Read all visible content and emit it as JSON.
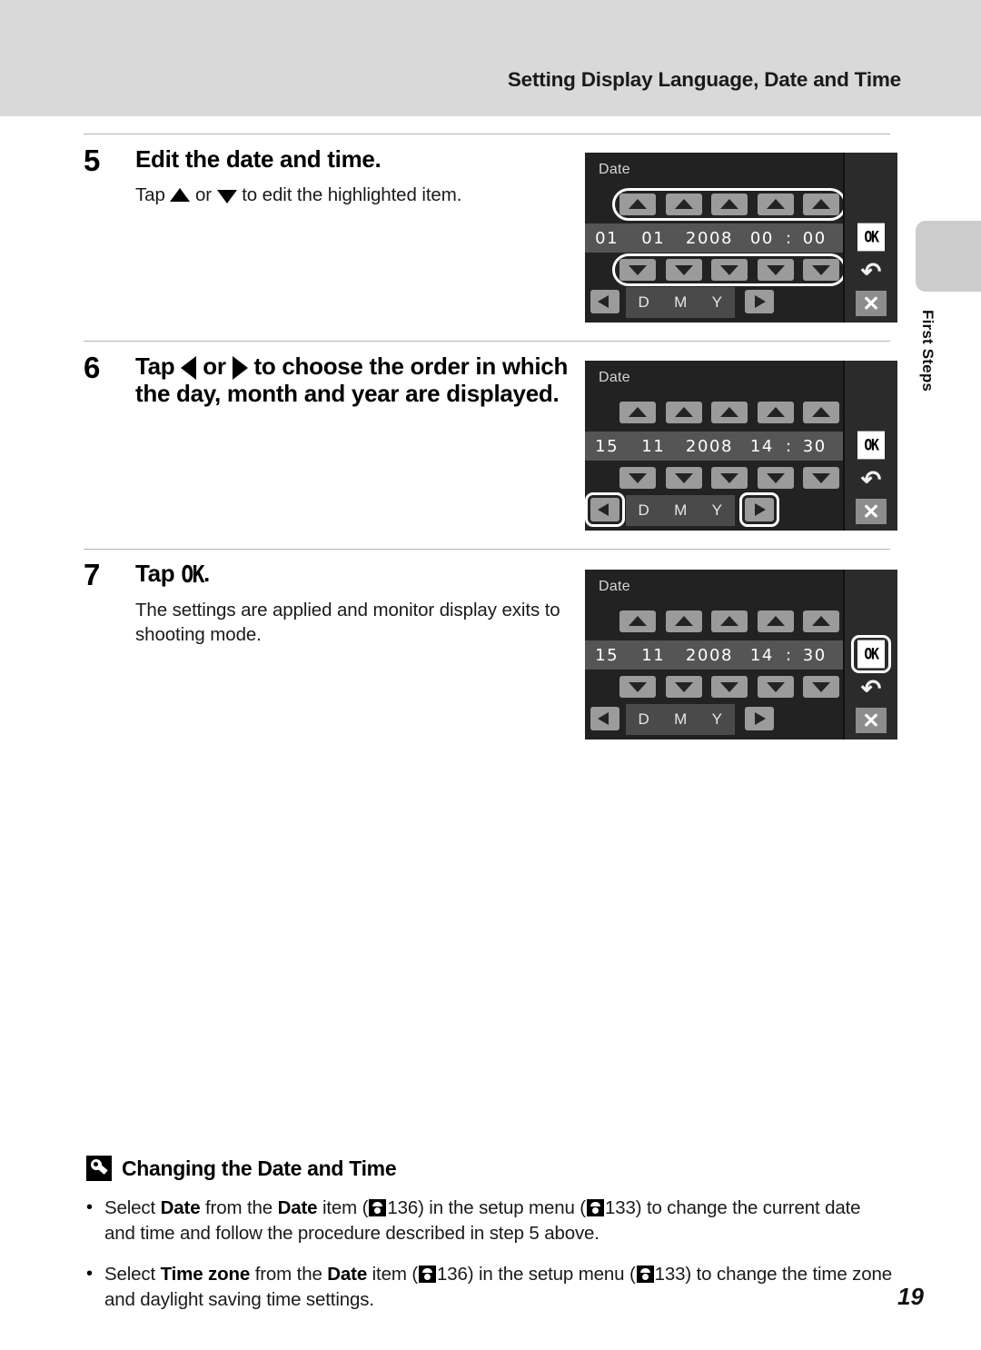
{
  "header": {
    "title": "Setting Display Language, Date and Time"
  },
  "side_tab": {
    "label": "First Steps"
  },
  "steps": [
    {
      "number": "5",
      "heading": "Edit the date and time.",
      "desc_before": "Tap ",
      "desc_mid": " or ",
      "desc_after": " to edit the highlighted item."
    },
    {
      "number": "6",
      "heading_before": "Tap ",
      "heading_mid": " or ",
      "heading_after": " to choose the order in which the day, month and year are displayed."
    },
    {
      "number": "7",
      "heading_before": "Tap ",
      "heading_ok": "OK",
      "heading_after": ".",
      "desc": "The settings are applied and monitor display exits to shooting mode."
    }
  ],
  "screens": [
    {
      "title": "Date",
      "value": {
        "day": "01",
        "month": "01",
        "year": "2008",
        "hour": "00",
        "colon": ":",
        "minute": "00"
      },
      "order": {
        "d": "D",
        "m": "M",
        "y": "Y"
      },
      "sidebar": {
        "ok": "OK",
        "back": "back-arrow",
        "close": "close"
      },
      "highlight": "arrow-rows"
    },
    {
      "title": "Date",
      "value": {
        "day": "15",
        "month": "11",
        "year": "2008",
        "hour": "14",
        "colon": ":",
        "minute": "30"
      },
      "order": {
        "d": "D",
        "m": "M",
        "y": "Y"
      },
      "sidebar": {
        "ok": "OK",
        "back": "back-arrow",
        "close": "close"
      },
      "highlight": "left-right-buttons"
    },
    {
      "title": "Date",
      "value": {
        "day": "15",
        "month": "11",
        "year": "2008",
        "hour": "14",
        "colon": ":",
        "minute": "30"
      },
      "order": {
        "d": "D",
        "m": "M",
        "y": "Y"
      },
      "sidebar": {
        "ok": "OK",
        "back": "back-arrow",
        "close": "close"
      },
      "highlight": "ok-button"
    }
  ],
  "note": {
    "title": "Changing the Date and Time",
    "bullet": "•",
    "items": [
      {
        "t1": "Select ",
        "b1": "Date",
        "t2": " from the ",
        "b2": "Date",
        "t3": " item (",
        "ref1": "136",
        "t4": ") in the setup menu (",
        "ref2": "133",
        "t5": ") to change the current date and time and follow the procedure described in step 5 above."
      },
      {
        "t1": "Select ",
        "b1": "Time zone",
        "t2": " from the ",
        "b2": "Date",
        "t3": " item (",
        "ref1": "136",
        "t4": ") in the setup menu (",
        "ref2": "133",
        "t5": ") to change the time zone and daylight saving time settings."
      }
    ]
  },
  "page_number": "19"
}
